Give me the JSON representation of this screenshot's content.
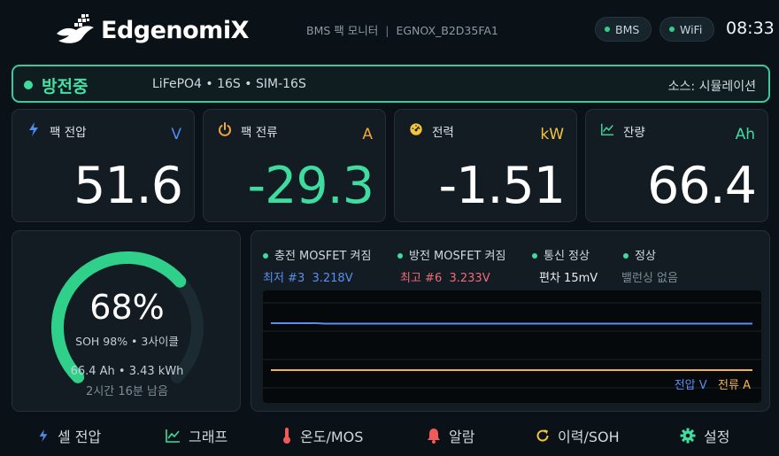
{
  "header": {
    "brand": "EdgenomiX",
    "device_title": "BMS 팩 모니터",
    "device_id": "EGNOX_B2D35FA1",
    "pills": {
      "bms": "BMS",
      "wifi": "WiFi"
    },
    "clock": "08:33"
  },
  "status": {
    "state": "방전중",
    "info": "LiFePO4 • 16S • SIM-16S",
    "source": "소스: 시뮬레이션"
  },
  "metrics": [
    {
      "label": "팩 전압",
      "unit": "V",
      "value": "51.6",
      "icon": "bolt-icon",
      "unit_color": "#4d8ef0",
      "value_color": "#ffffff"
    },
    {
      "label": "팩 전류",
      "unit": "A",
      "value": "-29.3",
      "icon": "power-icon",
      "unit_color": "#f0a73a",
      "value_color": "#3fdca0"
    },
    {
      "label": "전력",
      "unit": "kW",
      "value": "-1.51",
      "icon": "gauge-icon",
      "unit_color": "#f3c53a",
      "value_color": "#ffffff"
    },
    {
      "label": "잔량",
      "unit": "Ah",
      "value": "66.4",
      "icon": "chart-line-icon",
      "unit_color": "#3fdca0",
      "value_color": "#ffffff"
    }
  ],
  "soc": {
    "percent_text": "68%",
    "percent": 68,
    "soh": "SOH 98% • 3사이클",
    "capacity": "66.4 Ah • 3.43 kWh",
    "remaining": "2시간 16분 남음",
    "arc_color": "#2fd08a"
  },
  "indicators": [
    {
      "label": "충전 MOSFET 켜짐"
    },
    {
      "label": "방전 MOSFET 켜짐"
    },
    {
      "label": "통신 정상"
    },
    {
      "label": "정상"
    }
  ],
  "cells": {
    "min_label": "최저 #3",
    "min_value": "3.218V",
    "max_label": "최고 #6",
    "max_value": "3.233V",
    "delta": "편차 15mV",
    "balancing": "밸런싱 없음"
  },
  "chart_data": {
    "type": "line",
    "series": [
      {
        "name": "전압 V",
        "color": "#5b8ef0"
      },
      {
        "name": "전류 A",
        "color": "#f3b34a"
      }
    ]
  },
  "nav": [
    {
      "label": "셀 전압",
      "icon": "bolt-icon",
      "color": "#4d8ef0"
    },
    {
      "label": "그래프",
      "icon": "chart-line-icon",
      "color": "#3fdca0"
    },
    {
      "label": "온도/MOS",
      "icon": "thermometer-icon",
      "color": "#f05a5a"
    },
    {
      "label": "알람",
      "icon": "bell-icon",
      "color": "#f05a5a"
    },
    {
      "label": "이력/SOH",
      "icon": "refresh-icon",
      "color": "#f3c53a"
    },
    {
      "label": "설정",
      "icon": "gear-icon",
      "color": "#3fdca0"
    }
  ]
}
